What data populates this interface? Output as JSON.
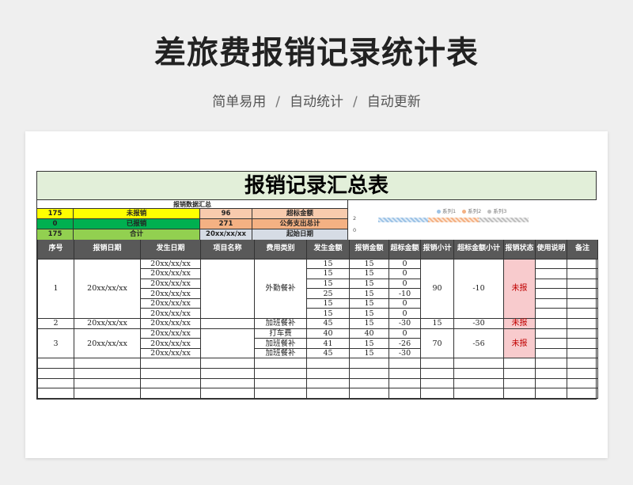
{
  "header": {
    "title": "差旅费报销记录统计表",
    "subtitle": [
      "简单易用",
      "自动统计",
      "自动更新"
    ],
    "separator": "/"
  },
  "sheet": {
    "title": "报销记录汇总表",
    "summary": {
      "heading": "报销数据汇总",
      "rows": [
        {
          "v1": "175",
          "l1": "未报销",
          "v2": "96",
          "l2": "超标金额"
        },
        {
          "v1": "0",
          "l1": "已报销",
          "v2": "271",
          "l2": "公务支出总计"
        },
        {
          "v1": "175",
          "l1": "合计",
          "v2": "20xx/xx/xx",
          "l2": "起始日期"
        }
      ]
    },
    "colors": {
      "yellow": "#ffff00",
      "green": "#00b050",
      "lightgreen": "#92d050",
      "peach": "#f8cbad",
      "lightpeach": "#fbe4d5",
      "bluegrey": "#d6dce5",
      "status_bg": "#f8cbcd",
      "status_text": "#c00000",
      "header_bg": "#595959"
    },
    "chart_data": {
      "type": "bar",
      "orientation": "horizontal",
      "legend": [
        "系列1",
        "系列2",
        "系列3"
      ],
      "legend_position": "top",
      "y_ticks": [
        "2",
        "0"
      ],
      "series": [
        {
          "name": "系列1",
          "values": [
            90
          ]
        },
        {
          "name": "系列2",
          "values": [
            90
          ]
        },
        {
          "name": "系列3",
          "values": [
            90
          ]
        }
      ]
    },
    "columns": [
      "序号",
      "报销日期",
      "发生日期",
      "项目名称",
      "费用类别",
      "发生金额",
      "报销金额",
      "超标金额",
      "报销小计",
      "超标金额小计",
      "报销状态",
      "使用说明",
      "备注"
    ],
    "groups": [
      {
        "seq": "1",
        "date": "20xx/xx/xx",
        "project": "",
        "category": "外勤餐补",
        "subtotal": "90",
        "over_subtotal": "-10",
        "status": "未报",
        "rows": [
          {
            "date": "20xx/xx/xx",
            "category": "",
            "amount": "15",
            "reimb": "15",
            "over": "0"
          },
          {
            "date": "20xx/xx/xx",
            "category": "",
            "amount": "15",
            "reimb": "15",
            "over": "0"
          },
          {
            "date": "20xx/xx/xx",
            "category": "",
            "amount": "15",
            "reimb": "15",
            "over": "0"
          },
          {
            "date": "20xx/xx/xx",
            "category": "",
            "amount": "25",
            "reimb": "15",
            "over": "-10"
          },
          {
            "date": "20xx/xx/xx",
            "category": "",
            "amount": "15",
            "reimb": "15",
            "over": "0"
          },
          {
            "date": "20xx/xx/xx",
            "category": "",
            "amount": "15",
            "reimb": "15",
            "over": "0"
          }
        ]
      },
      {
        "seq": "2",
        "date": "20xx/xx/xx",
        "project": "",
        "category": "",
        "subtotal": "15",
        "over_subtotal": "-30",
        "status": "未报",
        "rows": [
          {
            "date": "20xx/xx/xx",
            "category": "加班餐补",
            "amount": "45",
            "reimb": "15",
            "over": "-30"
          }
        ]
      },
      {
        "seq": "3",
        "date": "20xx/xx/xx",
        "project": "",
        "category": "",
        "subtotal": "70",
        "over_subtotal": "-56",
        "status": "未报",
        "rows": [
          {
            "date": "20xx/xx/xx",
            "category": "打车费",
            "amount": "40",
            "reimb": "40",
            "over": "0"
          },
          {
            "date": "20xx/xx/xx",
            "category": "加班餐补",
            "amount": "41",
            "reimb": "15",
            "over": "-26"
          },
          {
            "date": "20xx/xx/xx",
            "category": "加班餐补",
            "amount": "45",
            "reimb": "15",
            "over": "-30"
          }
        ]
      }
    ],
    "empty_rows": 4
  }
}
